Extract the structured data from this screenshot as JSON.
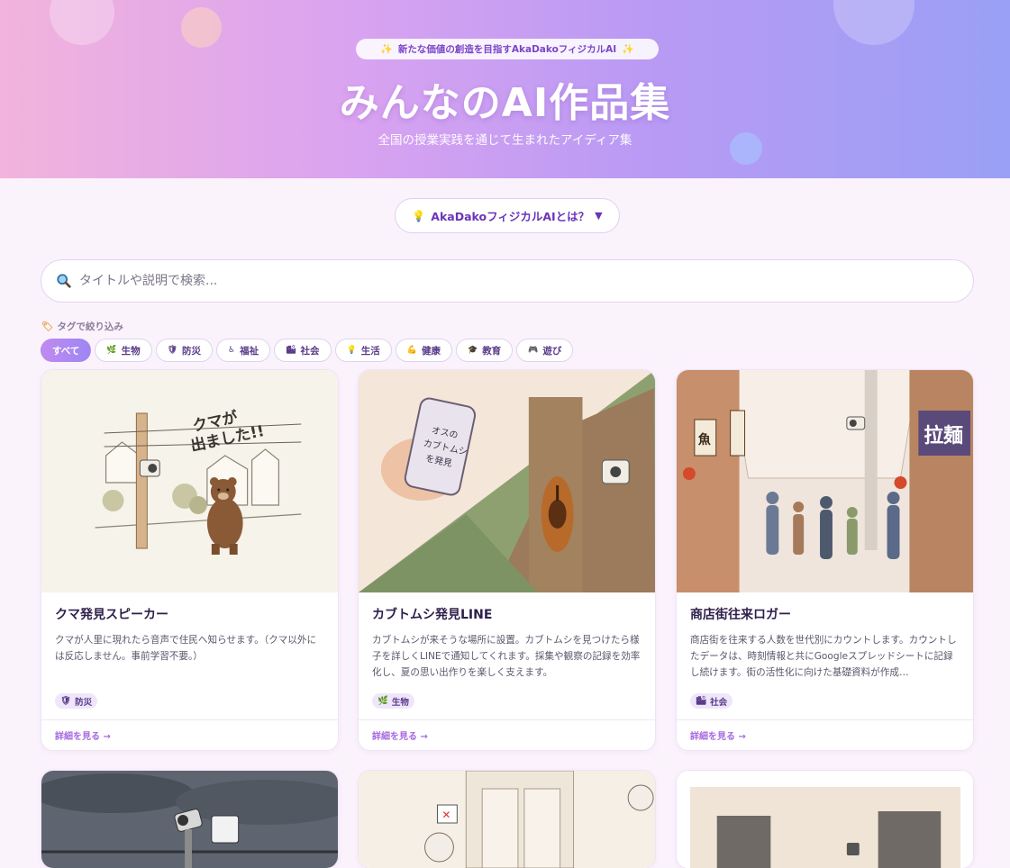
{
  "hero": {
    "badge": "新たな価値の創造を目指すAkaDakoフィジカルAI",
    "title": "みんなのAI作品集",
    "subtitle": "全国の授業実践を通じて生まれたアイディア集"
  },
  "about": {
    "label": "AkaDakoフィジカルAIとは？",
    "caret": "▼"
  },
  "search": {
    "placeholder": "タイトルや説明で検索..."
  },
  "tags": {
    "label": "タグで絞り込み",
    "items": [
      {
        "label": "すべて",
        "icon": ""
      },
      {
        "label": "生物",
        "icon": "leaf-icon"
      },
      {
        "label": "防災",
        "icon": "shield-icon"
      },
      {
        "label": "福祉",
        "icon": "wheelchair-icon"
      },
      {
        "label": "社会",
        "icon": "city-icon"
      },
      {
        "label": "生活",
        "icon": "bulb-icon"
      },
      {
        "label": "健康",
        "icon": "muscle-icon"
      },
      {
        "label": "教育",
        "icon": "graduation-cap-icon"
      },
      {
        "label": "遊び",
        "icon": "gamepad-icon"
      }
    ]
  },
  "cards": [
    {
      "title": "クマ発見スピーカー",
      "description": "クマが人里に現れたら音声で住民へ知らせます。（クマ以外には反応しません。事前学習不要。）",
      "tag": "防災",
      "tag_icon": "shield-icon",
      "link": "詳細を見る →",
      "image_text": "クマが出ました!!"
    },
    {
      "title": "カブトムシ発見LINE",
      "description": "カブトムシが来そうな場所に設置。カブトムシを見つけたら様子を詳しくLINEで通知してくれます。採集や観察の記録を効率化し、夏の思い出作りを楽しく支えます。",
      "tag": "生物",
      "tag_icon": "leaf-icon",
      "link": "詳細を見る →",
      "image_text": "オスのカブトムシを発見"
    },
    {
      "title": "商店街往来ロガー",
      "description": "商店街を往来する人数を世代別にカウントします。カウントしたデータは、時刻情報と共にGoogleスプレッドシートに記録し続けます。街の活性化に向けた基礎資料が作成…",
      "tag": "社会",
      "tag_icon": "city-icon",
      "link": "詳細を見る →",
      "image_text": "拉麺"
    }
  ],
  "colors": {
    "accent": "#a86ae0",
    "hero_start": "#f2b3dc",
    "hero_end": "#9aa0f5"
  }
}
